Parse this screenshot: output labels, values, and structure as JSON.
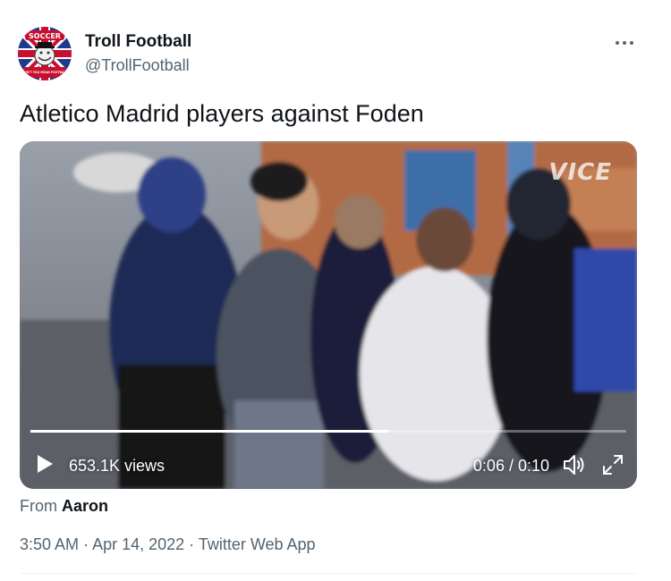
{
  "author": {
    "display_name": "Troll Football",
    "handle": "@TrollFootball",
    "avatar_text_top": "SOCCER",
    "avatar_text_bottom": "DON'T YOU MEAN FOOTBALL"
  },
  "tweet": {
    "text": "Atletico Madrid players against Foden"
  },
  "video": {
    "watermark": "VICE",
    "views": "653.1K views",
    "time": "0:06 / 0:10",
    "progress_fraction": 0.6,
    "icons": {
      "play": "play-icon",
      "volume": "volume-icon",
      "fullscreen": "fullscreen-icon"
    }
  },
  "attribution": {
    "prefix": "From",
    "name": "Aaron"
  },
  "meta": {
    "time": "3:50 AM",
    "separator": " · ",
    "date": "Apr 14, 2022",
    "source": "Twitter Web App"
  },
  "more_icon": "more-horizontal-icon",
  "colors": {
    "text_primary": "#0f1419",
    "text_secondary": "#536471",
    "divider": "#eff3f4"
  }
}
